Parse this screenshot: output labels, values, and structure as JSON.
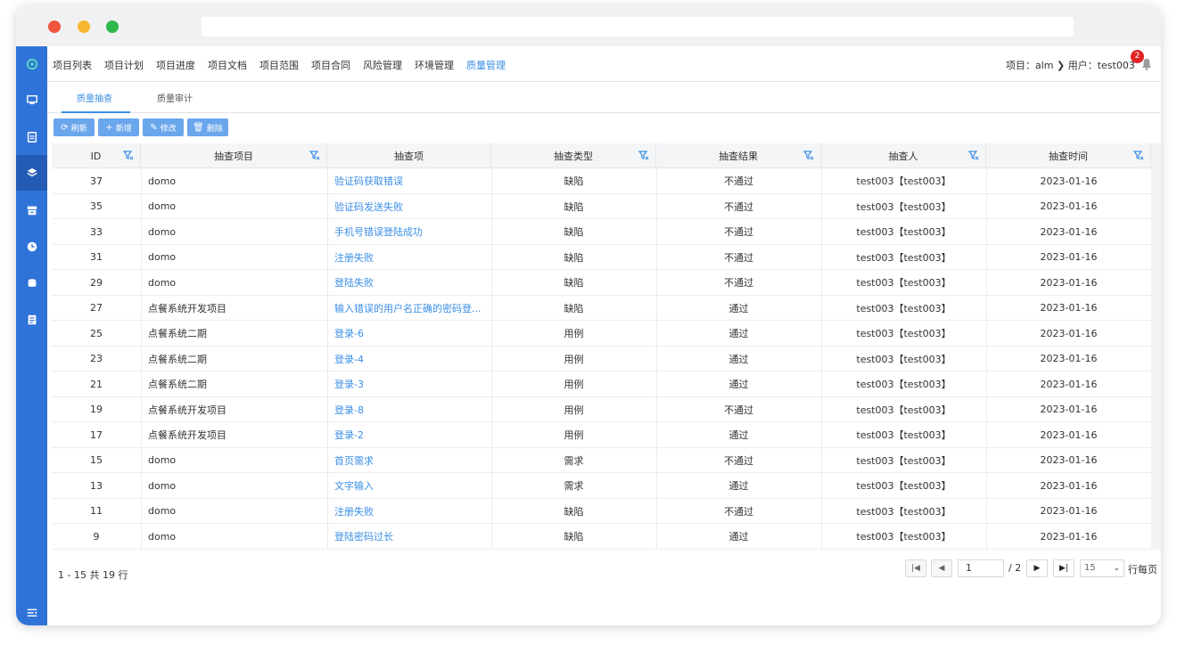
{
  "nav": {
    "items": [
      "项目列表",
      "项目计划",
      "项目进度",
      "项目文档",
      "项目范围",
      "项目合同",
      "风险管理",
      "环境管理",
      "质量管理"
    ],
    "active_index": 8,
    "context": "项目：alm  ❯ 用户：test003",
    "notification_count": "2"
  },
  "tabs": [
    "质量抽查",
    "质量审计"
  ],
  "toolbar": {
    "refresh": "刷新",
    "add": "新增",
    "edit": "修改",
    "delete": "删除"
  },
  "table": {
    "columns": [
      "ID",
      "抽查项目",
      "抽查项",
      "抽查类型",
      "抽查结果",
      "抽查人",
      "抽查时间"
    ],
    "rows": [
      [
        "37",
        "domo",
        "验证码获取错误",
        "缺陷",
        "不通过",
        "test003【test003】",
        "2023-01-16"
      ],
      [
        "35",
        "domo",
        "验证码发送失败",
        "缺陷",
        "不通过",
        "test003【test003】",
        "2023-01-16"
      ],
      [
        "33",
        "domo",
        "手机号错误登陆成功",
        "缺陷",
        "不通过",
        "test003【test003】",
        "2023-01-16"
      ],
      [
        "31",
        "domo",
        "注册失败",
        "缺陷",
        "不通过",
        "test003【test003】",
        "2023-01-16"
      ],
      [
        "29",
        "domo",
        "登陆失败",
        "缺陷",
        "不通过",
        "test003【test003】",
        "2023-01-16"
      ],
      [
        "27",
        "点餐系统开发项目",
        "输入错误的用户名正确的密码登...",
        "缺陷",
        "通过",
        "test003【test003】",
        "2023-01-16"
      ],
      [
        "25",
        "点餐系统二期",
        "登录-6",
        "用例",
        "通过",
        "test003【test003】",
        "2023-01-16"
      ],
      [
        "23",
        "点餐系统二期",
        "登录-4",
        "用例",
        "通过",
        "test003【test003】",
        "2023-01-16"
      ],
      [
        "21",
        "点餐系统二期",
        "登录-3",
        "用例",
        "通过",
        "test003【test003】",
        "2023-01-16"
      ],
      [
        "19",
        "点餐系统开发项目",
        "登录-8",
        "用例",
        "不通过",
        "test003【test003】",
        "2023-01-16"
      ],
      [
        "17",
        "点餐系统开发项目",
        "登录-2",
        "用例",
        "通过",
        "test003【test003】",
        "2023-01-16"
      ],
      [
        "15",
        "domo",
        "首页需求",
        "需求",
        "不通过",
        "test003【test003】",
        "2023-01-16"
      ],
      [
        "13",
        "domo",
        "文字输入",
        "需求",
        "通过",
        "test003【test003】",
        "2023-01-16"
      ],
      [
        "11",
        "domo",
        "注册失败",
        "缺陷",
        "不通过",
        "test003【test003】",
        "2023-01-16"
      ],
      [
        "9",
        "domo",
        "登陆密码过长",
        "缺陷",
        "通过",
        "test003【test003】",
        "2023-01-16"
      ]
    ]
  },
  "pagination": {
    "info": "1 - 15 共 19 行",
    "current_page": "1",
    "total_pages": "/ 2",
    "page_size": "15",
    "per_page_label": "行每页"
  },
  "colors": {
    "accent": "#3a8ee6",
    "sidebar": "#2f73d9",
    "button": "#6aa6ec"
  }
}
